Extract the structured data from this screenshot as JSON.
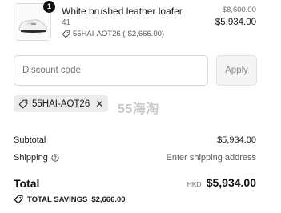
{
  "line_item": {
    "quantity": "1",
    "title": "White brushed leather loafer",
    "variant": "41",
    "discount_label": "55HAI-AOT26 (-$2,666.00)",
    "original_price": "$8,600.00",
    "price": "$5,934.00"
  },
  "discount_form": {
    "placeholder": "Discount code",
    "apply_label": "Apply"
  },
  "applied_code": {
    "code": "55HAI-AOT26",
    "remove_symbol": "✕"
  },
  "watermark": "55海淘",
  "summary": {
    "subtotal_label": "Subtotal",
    "subtotal_value": "$5,934.00",
    "shipping_label": "Shipping",
    "shipping_value": "Enter shipping address",
    "total_label": "Total",
    "currency": "HKD",
    "total_value": "$5,934.00",
    "savings_label": "TOTAL SAVINGS",
    "savings_value": "$2,666.00"
  },
  "icons": {
    "tag": "tag-icon",
    "help": "question-circle-icon",
    "remove": "close-icon",
    "product": "loafer-image"
  }
}
